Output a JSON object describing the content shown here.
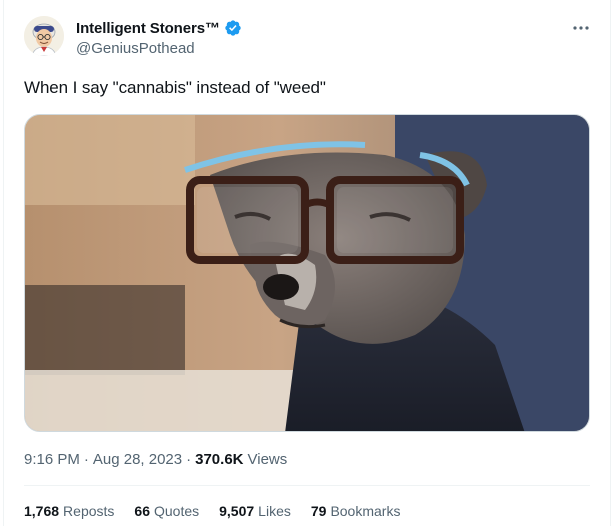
{
  "author": {
    "display_name": "Intelligent Stoners™",
    "handle": "@GeniusPothead",
    "verified": true,
    "avatar_icon": "cartoon-scientist-avatar"
  },
  "tweet": {
    "text": "When I say \"cannabis\" instead of \"weed\"",
    "media_icon": "dog-wearing-glasses-photo"
  },
  "meta": {
    "time": "9:16 PM",
    "date": "Aug 28, 2023",
    "views_count": "370.6K",
    "views_label": "Views",
    "separator": "·"
  },
  "stats": {
    "reposts_count": "1,768",
    "reposts_label": "Reposts",
    "quotes_count": "66",
    "quotes_label": "Quotes",
    "likes_count": "9,507",
    "likes_label": "Likes",
    "bookmarks_count": "79",
    "bookmarks_label": "Bookmarks"
  },
  "colors": {
    "verified_blue": "#1d9bf0",
    "secondary_text": "#536471",
    "primary_text": "#0f1419"
  }
}
